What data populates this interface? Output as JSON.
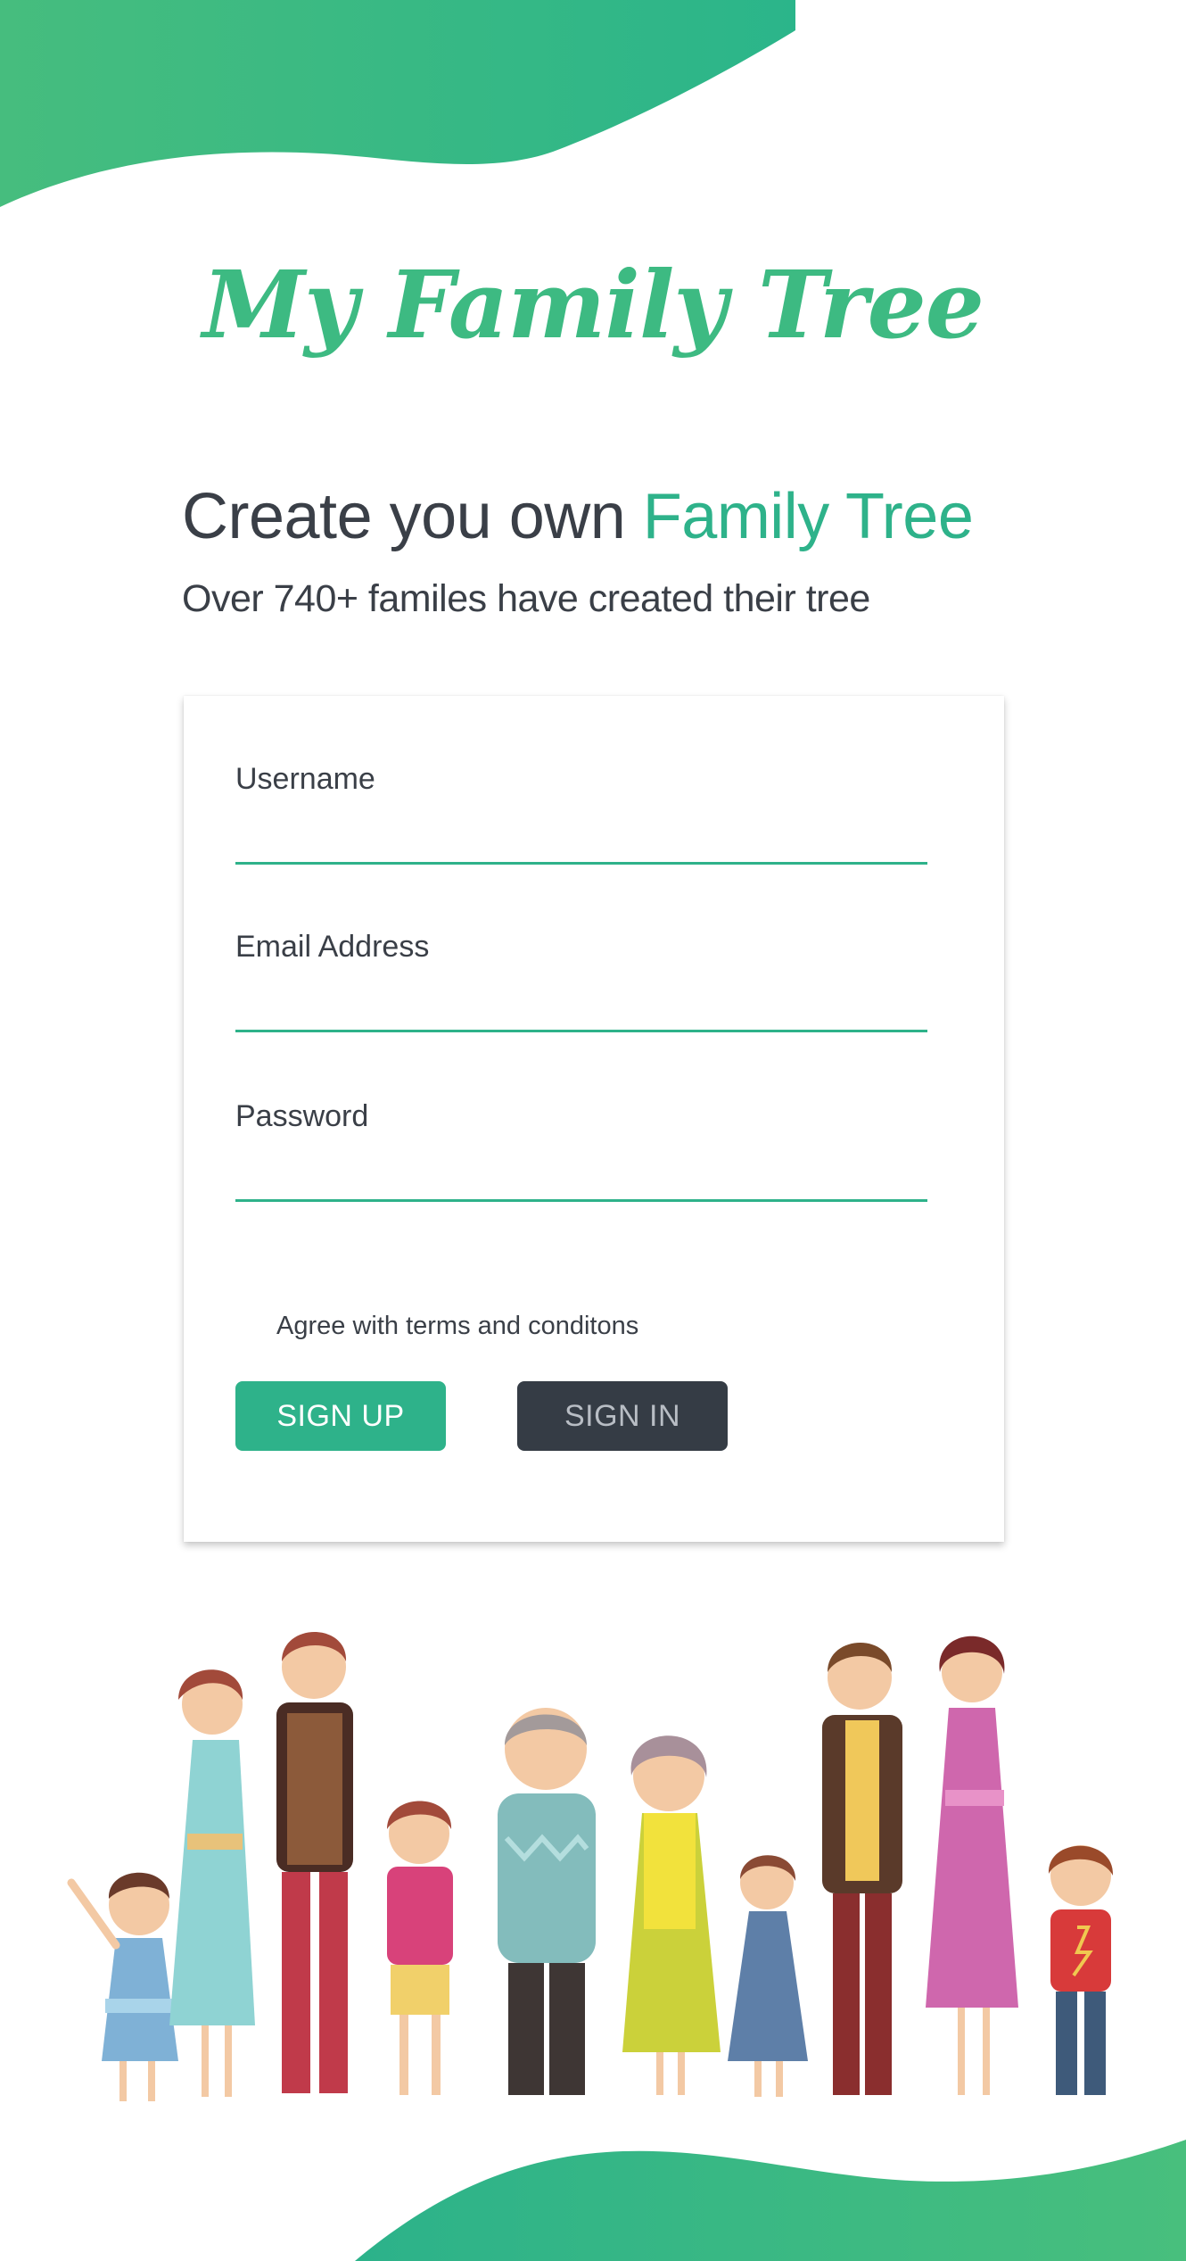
{
  "app": {
    "logo_text": "My Family Tree"
  },
  "hero": {
    "headline_prefix": "Create you own ",
    "headline_accent": "Family Tree",
    "subline": "Over 740+ familes have created their tree"
  },
  "form": {
    "username_label": "Username",
    "username_value": "",
    "email_label": "Email Address",
    "email_value": "",
    "password_label": "Password",
    "password_value": "",
    "terms_label": "Agree with terms and conditons",
    "terms_checked": false,
    "signup_label": "SIGN UP",
    "signin_label": "SIGN IN"
  },
  "colors": {
    "brand_green": "#2eb28a",
    "logo_green": "#3dba82",
    "dark_button": "#353c45",
    "text": "#3a3f47"
  },
  "illustration": {
    "name": "family-illustration-icon"
  }
}
